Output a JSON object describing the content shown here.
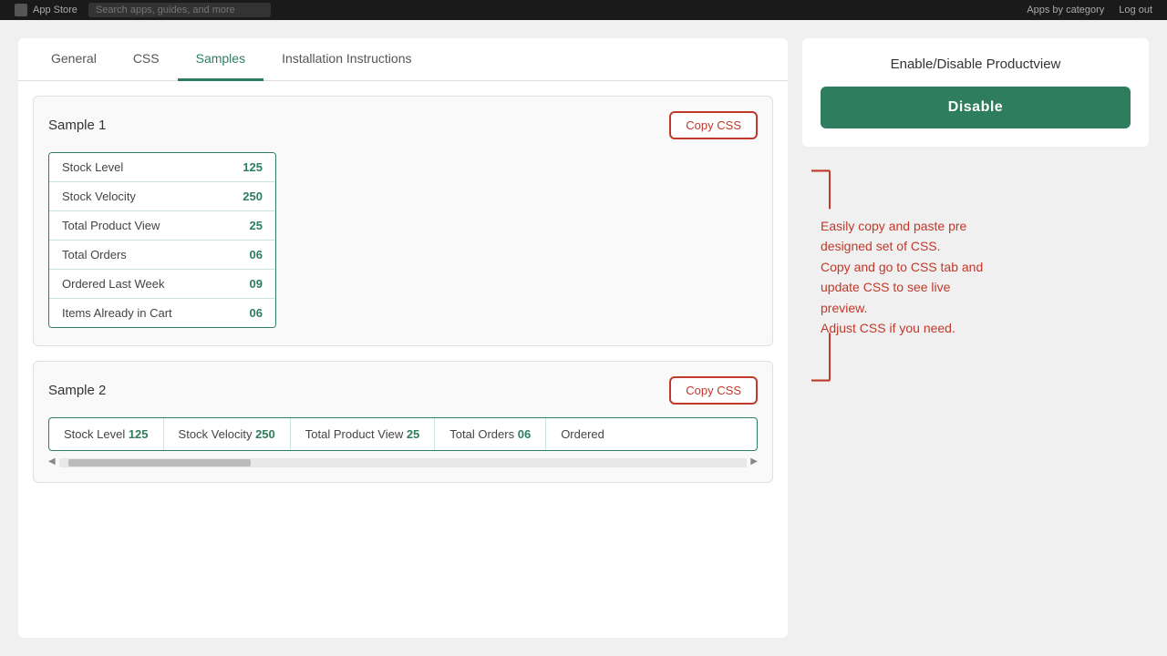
{
  "topbar": {
    "logo_text": "App Store",
    "search_placeholder": "Search apps, guides, and more",
    "nav_label": "Apps by category",
    "action_label": "Log out"
  },
  "tabs": [
    {
      "id": "general",
      "label": "General",
      "active": false
    },
    {
      "id": "css",
      "label": "CSS",
      "active": false
    },
    {
      "id": "samples",
      "label": "Samples",
      "active": true
    },
    {
      "id": "installation",
      "label": "Installation Instructions",
      "active": false
    }
  ],
  "sample1": {
    "title": "Sample 1",
    "copy_btn": "Copy CSS",
    "rows": [
      {
        "label": "Stock Level",
        "value": "125"
      },
      {
        "label": "Stock Velocity",
        "value": "250"
      },
      {
        "label": "Total Product View",
        "value": "25"
      },
      {
        "label": "Total Orders",
        "value": "06"
      },
      {
        "label": "Ordered Last Week",
        "value": "09"
      },
      {
        "label": "Items Already in Cart",
        "value": "06"
      }
    ]
  },
  "sample2": {
    "title": "Sample 2",
    "copy_btn": "Copy CSS",
    "cells": [
      {
        "label": "Stock Level",
        "value": "125"
      },
      {
        "label": "Stock Velocity",
        "value": "250"
      },
      {
        "label": "Total Product View",
        "value": "25"
      },
      {
        "label": "Total Orders",
        "value": "06"
      },
      {
        "label": "Ordered",
        "value": ""
      }
    ]
  },
  "enable_disable": {
    "title": "Enable/Disable Productview",
    "disable_label": "Disable"
  },
  "callout": {
    "line1": "Easily copy and paste pre",
    "line2": "designed set of CSS.",
    "line3": "Copy and go to CSS tab and",
    "line4": "update CSS to see live",
    "line5": "preview.",
    "line6": "Adjust CSS if you need."
  }
}
